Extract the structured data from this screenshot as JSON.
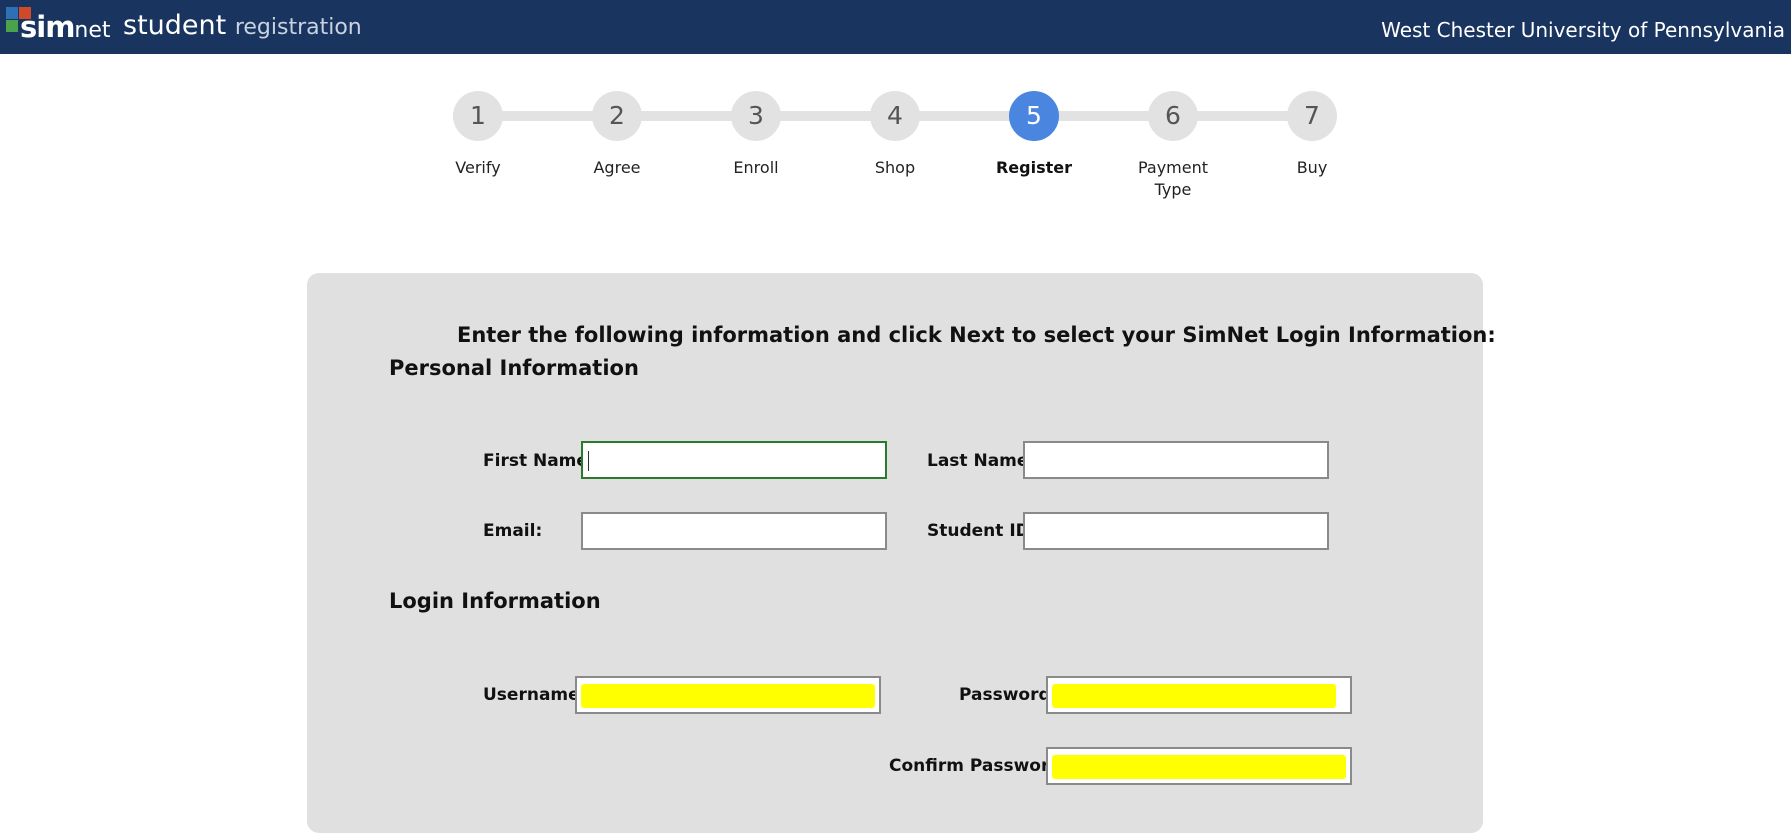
{
  "header": {
    "logo_main": "sim",
    "logo_sub": "net",
    "logo_colors": [
      "#2f6fb5",
      "#d04a2a",
      "#4aa34a",
      "#1f4f90"
    ],
    "title_main": "student",
    "title_sub": "registration",
    "institution": "West Chester University of Pennsylvania",
    "background_color": "#19345e"
  },
  "steps": [
    {
      "number": "1",
      "label": "Verify",
      "active": false
    },
    {
      "number": "2",
      "label": "Agree",
      "active": false
    },
    {
      "number": "3",
      "label": "Enroll",
      "active": false
    },
    {
      "number": "4",
      "label": "Shop",
      "active": false
    },
    {
      "number": "5",
      "label": "Register",
      "active": true
    },
    {
      "number": "6",
      "label": "Payment Type",
      "active": false
    },
    {
      "number": "7",
      "label": "Buy",
      "active": false
    }
  ],
  "accent_color": "#4a86e0",
  "form": {
    "instruction": "Enter the following information and click Next to select your SimNet Login Information:",
    "personal_title": "Personal Information",
    "login_title": "Login Information",
    "fields": {
      "first_name": {
        "label": "First Name:",
        "value": ""
      },
      "last_name": {
        "label": "Last Name:",
        "value": ""
      },
      "email": {
        "label": "Email:",
        "value": ""
      },
      "student_id": {
        "label": "Student ID:",
        "value": ""
      },
      "username": {
        "label": "Username:"
      },
      "password": {
        "label": "Password:"
      },
      "confirm_password": {
        "label": "Confirm Password:"
      }
    }
  }
}
